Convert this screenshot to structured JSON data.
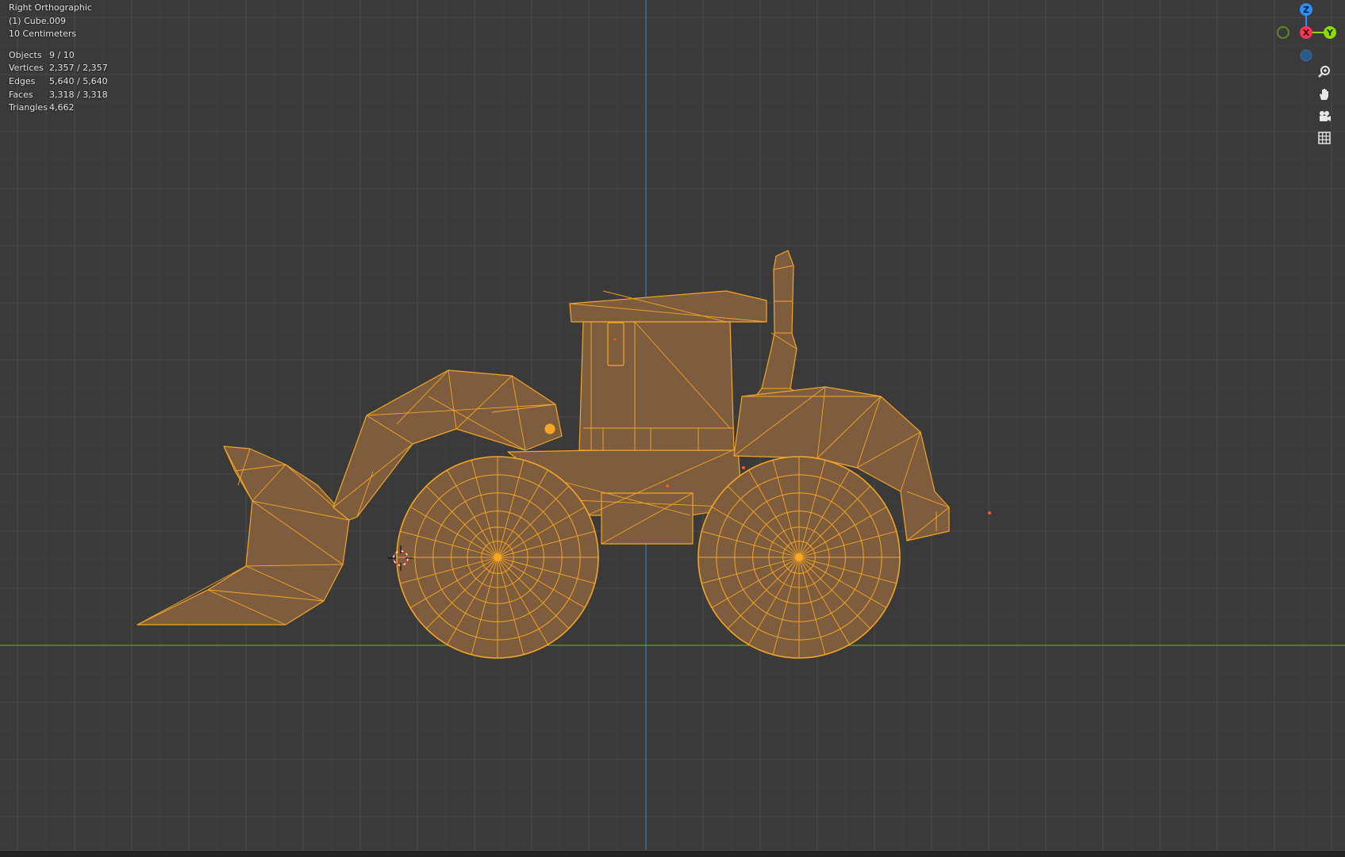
{
  "viewport": {
    "view_name": "Right Orthographic",
    "active_object": "(1) Cube.009",
    "grid_scale": "10 Centimeters",
    "stats": [
      {
        "label": "Objects",
        "value": "9 / 10"
      },
      {
        "label": "Vertices",
        "value": "2,357 / 2,357"
      },
      {
        "label": "Edges",
        "value": "5,640 / 5,640"
      },
      {
        "label": "Faces",
        "value": "3,318 / 3,318"
      },
      {
        "label": "Triangles",
        "value": "4,662"
      }
    ]
  },
  "gizmo": {
    "z_label": "Z",
    "x_label": "X",
    "y_label": "Y",
    "colors": {
      "x": "#ff3352",
      "y": "#8bdc00",
      "z": "#2890ff",
      "neg_y": "#5a7a2a",
      "neg_z": "#2a5a8a"
    }
  },
  "nav_buttons": [
    "zoom-icon",
    "hand-pan-icon",
    "camera-icon",
    "grid-toggle-icon"
  ],
  "colors": {
    "background": "#3a3a3a",
    "selection_wire": "#f5a623",
    "selection_fill": "#8a6440",
    "axis_z": "#2f7cc6",
    "axis_y": "#6c9a2c"
  }
}
